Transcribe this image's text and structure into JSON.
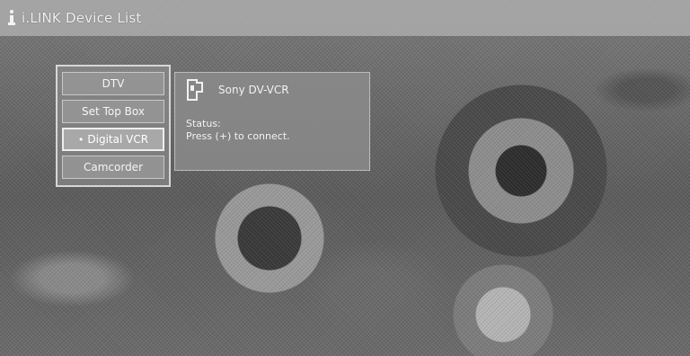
{
  "window": {
    "title": "i.LINK Device List"
  },
  "device_list": {
    "items": [
      {
        "label": "DTV",
        "selected": false
      },
      {
        "label": "Set Top Box",
        "selected": false
      },
      {
        "label": "Digital VCR",
        "selected": true
      },
      {
        "label": "Camcorder",
        "selected": false
      }
    ],
    "selected_marker": "•"
  },
  "info_panel": {
    "icon": "dv-vcr-device-icon",
    "device_name": "Sony DV-VCR",
    "status_label": "Status:",
    "status_message": "Press (+) to connect."
  },
  "colors": {
    "panel": "#8c8c8c",
    "text": "#f2f2f2",
    "title_bar": "#afafaf"
  }
}
